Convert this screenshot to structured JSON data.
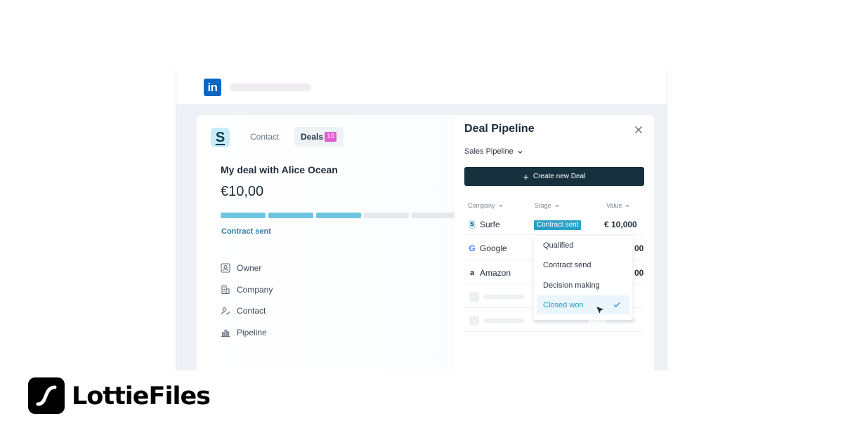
{
  "brand": {
    "name": "LottieFiles"
  },
  "browser": {
    "logo": "in"
  },
  "card": {
    "app_logo": "S",
    "tabs": {
      "contact": "Contact",
      "deals": "Deals",
      "deals_count": "10"
    },
    "deal_title": "My deal with Alice Ocean",
    "deal_amount": "€10,00",
    "progress": {
      "segments_total": 5,
      "segments_complete": 3
    },
    "stage_label": "Contract sent",
    "meta": [
      {
        "label": "Owner",
        "icon": "user-icon"
      },
      {
        "label": "Company",
        "icon": "building-icon"
      },
      {
        "label": "Contact",
        "icon": "contact-icon"
      },
      {
        "label": "Pipeline",
        "icon": "chart-icon"
      }
    ]
  },
  "pipeline": {
    "title": "Deal Pipeline",
    "selector": "Sales Pipeline",
    "create_button": "Create new Deal",
    "columns": {
      "company": "Company",
      "stage": "Stage",
      "value": "Value"
    },
    "rows": [
      {
        "company": "Surfe",
        "stage": "Contract sent",
        "value": "€ 10,000"
      },
      {
        "company": "Google",
        "value": "00"
      },
      {
        "company": "Amazon",
        "value": "00"
      }
    ],
    "dropdown": {
      "options": [
        "Qualified",
        "Contract send",
        "Decision making",
        "Closed won"
      ],
      "selected": "Closed won"
    }
  },
  "colors": {
    "accent": "#2aa0c6",
    "dark_button": "#16303d",
    "badge": "#e35ad0",
    "linkedin": "#0a66c2"
  }
}
